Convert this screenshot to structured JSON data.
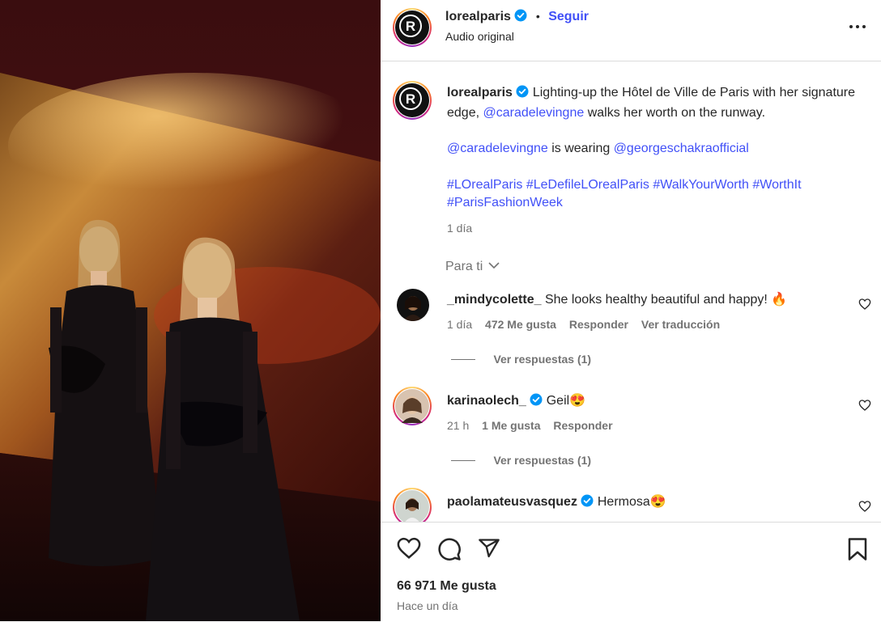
{
  "post_header": {
    "username": "lorealparis",
    "separator": "•",
    "follow_label": "Seguir",
    "audio_label": "Audio original"
  },
  "caption": {
    "username": "lorealparis",
    "text_1": "Lighting-up the Hôtel de Ville de Paris with her signature edge, ",
    "mention_1": "@caradelevingne",
    "text_2": " walks her worth on the runway.",
    "mention_2": "@caradelevingne",
    "text_3": " is wearing ",
    "mention_3": "@georgeschakraofficial",
    "hashtags_line1": "#LOrealParis #LeDefileLOrealParis #WalkYourWorth #WorthIt",
    "hashtags_line2": "#ParisFashionWeek",
    "time": "1 día"
  },
  "for_you_label": "Para ti",
  "comments": [
    {
      "username": "_mindycolette_",
      "text": "She looks healthy beautiful and happy! 🔥",
      "time": "1 día",
      "likes": "472 Me gusta",
      "reply": "Responder",
      "translate": "Ver traducción",
      "view_replies": "Ver respuestas (1)"
    },
    {
      "username": "karinaolech_",
      "text": "Geil😍",
      "time": "21 h",
      "likes": "1 Me gusta",
      "reply": "Responder",
      "view_replies": "Ver respuestas (1)"
    },
    {
      "username": "paolamateusvasquez",
      "text": "Hermosa😍"
    }
  ],
  "footer": {
    "likes_count": "66 971 Me gusta",
    "posted": "Hace un día"
  },
  "colors": {
    "link": "#4150f7",
    "verified": "#0095f6",
    "muted": "#737373",
    "divider": "#dbdbdb"
  },
  "icons": [
    "heart-icon",
    "comment-icon",
    "share-icon",
    "bookmark-icon",
    "more-icon",
    "verified-icon",
    "chevron-down-icon"
  ]
}
